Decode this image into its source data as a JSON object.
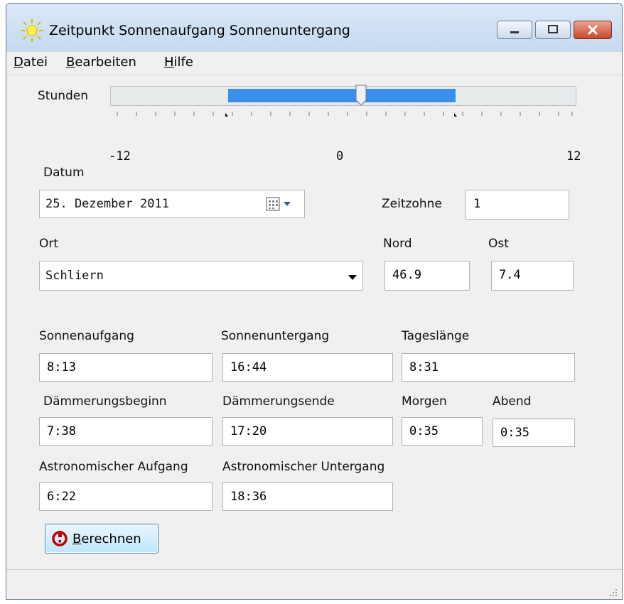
{
  "window": {
    "title": "Zeitpunkt Sonnenaufgang Sonnenuntergang",
    "icon": "sun-icon",
    "controls": [
      "minimize-icon",
      "maximize-icon",
      "close-icon"
    ]
  },
  "menu": [
    {
      "label": "Datei"
    },
    {
      "label": "Bearbeiten"
    },
    {
      "label": "Hilfe"
    }
  ],
  "slider": {
    "label": "Stunden",
    "tick_labels": [
      "-12",
      "0",
      "12"
    ],
    "min": -12,
    "max": 12,
    "value": 0,
    "range_start": -5,
    "range_end": 5,
    "accent": "#3b8fec"
  },
  "date": {
    "label": "Datum",
    "value": "25. Dezember 2011"
  },
  "timezone": {
    "label": "Zeitzohne",
    "value": "1"
  },
  "location": {
    "label": "Ort",
    "value": "Schliern"
  },
  "north": {
    "label": "Nord",
    "value": "46.9"
  },
  "east": {
    "label": "Ost",
    "value": "7.4"
  },
  "results": {
    "sunrise": {
      "label": "Sonnenaufgang",
      "value": "8:13"
    },
    "sunset": {
      "label": "Sonnenuntergang",
      "value": "16:44"
    },
    "day_length": {
      "label": "Tageslänge",
      "value": "8:31"
    },
    "dusk_begin": {
      "label": "Dämmerungsbeginn",
      "value": "7:38"
    },
    "dusk_end": {
      "label": "Dämmerungsende",
      "value": "17:20"
    },
    "morning": {
      "label": "Morgen",
      "value": "0:35"
    },
    "evening": {
      "label": "Abend",
      "value": "0:35"
    },
    "astro_rise": {
      "label": "Astronomischer Aufgang",
      "value": "6:22"
    },
    "astro_set": {
      "label": "Astronomischer Untergang",
      "value": "18:36"
    }
  },
  "calculate_button": {
    "label": "Berechnen",
    "icon": "calculate-icon"
  }
}
